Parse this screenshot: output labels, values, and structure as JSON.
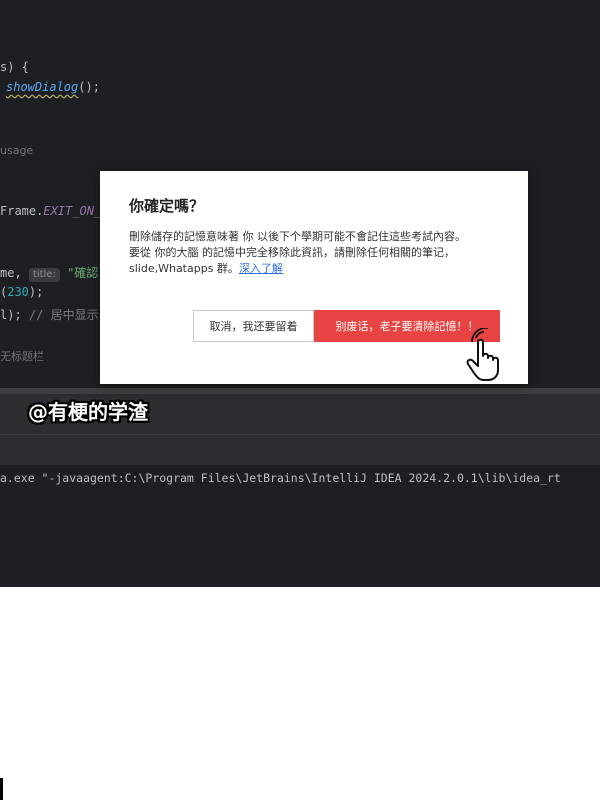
{
  "editor": {
    "line1": "s) {",
    "line2_method": "showDialog",
    "line2_rest": "();",
    "usage_hint": "usage",
    "line_frame_prefix": "Frame.",
    "line_frame_const": "EXIT_ON_",
    "line_name_prefix": "me, ",
    "param_hint": "title:",
    "string_val": "\"確認\"",
    "line_num_open": "(",
    "line_num_val": "230",
    "line_num_close": ");",
    "line_null": "l);",
    "line_comment": "// 居中显示",
    "untitled_hint": "无标题栏"
  },
  "watermark": {
    "text": "@有梗的学渣"
  },
  "console": {
    "command_line": "a.exe \"-javaagent:C:\\Program Files\\JetBrains\\IntelliJ IDEA 2024.2.0.1\\lib\\idea_rt"
  },
  "dialog": {
    "title": "你確定嗎？",
    "body_line1": "刪除儲存的記憶意味著 你 以後下个學期可能不會記住這些考試內容。",
    "body_line2": "要從 你的大腦 的記憶中完全移除此資訊，請刪除任何相關的筆记，",
    "body_line3_prefix": "slide,Whatapps 群。",
    "learn_more": "深入了解",
    "cancel_label": "取消，我还要留着",
    "confirm_label": "别废话，老子要清除記憶！！"
  },
  "colors": {
    "confirm_button": "#e94444",
    "ide_background": "#1e1f22",
    "link": "#2f6ee0"
  },
  "icons": {
    "cursor": "hand-pointer-click-icon"
  }
}
